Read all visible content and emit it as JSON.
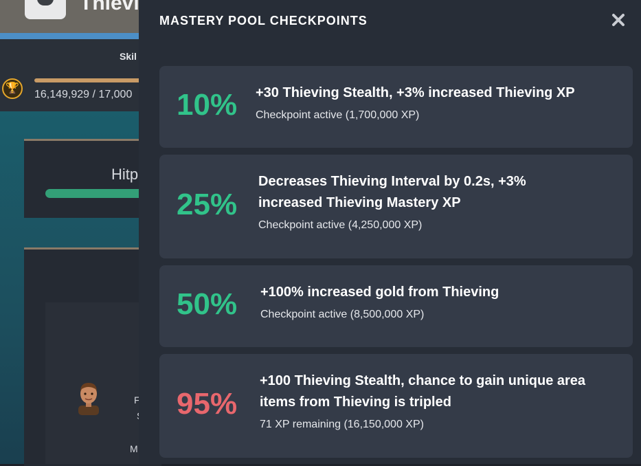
{
  "background": {
    "title": "Thievi",
    "skill_label": "Skil",
    "xp_text": "16,149,929 / 17,000",
    "hitpoints_label": "Hitp",
    "letters": [
      "F",
      "S",
      "M"
    ],
    "trophy_icon": "trophy-icon",
    "npc_icon": "npc-portrait-icon"
  },
  "modal": {
    "title": "MASTERY POOL CHECKPOINTS",
    "close_icon": "close-icon",
    "accent_active": "#31c38a",
    "accent_inactive": "#e8676d",
    "checkpoints": [
      {
        "percent": "10%",
        "description": "+30 Thieving Stealth, +3% increased Thieving XP",
        "status": "Checkpoint active (1,700,000 XP)",
        "active": true
      },
      {
        "percent": "25%",
        "description": "Decreases Thieving Interval by 0.2s, +3% increased Thieving Mastery XP",
        "status": "Checkpoint active (4,250,000 XP)",
        "active": true
      },
      {
        "percent": "50%",
        "description": "+100% increased gold from Thieving",
        "status": "Checkpoint active (8,500,000 XP)",
        "active": true
      },
      {
        "percent": "95%",
        "description": "+100 Thieving Stealth, chance to gain unique area items from Thieving is tripled",
        "status": "71 XP remaining (16,150,000 XP)",
        "active": false
      }
    ]
  }
}
